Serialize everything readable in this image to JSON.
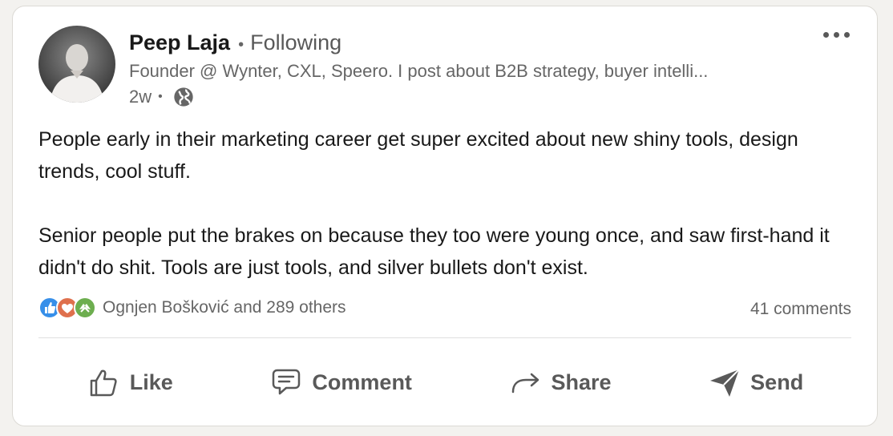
{
  "author": {
    "name": "Peep Laja",
    "follow_status": "Following",
    "headline": "Founder @ Wynter, CXL, Speero. I post about B2B strategy, buyer intelli...",
    "time_ago": "2w",
    "visibility_icon": "globe-icon"
  },
  "post": {
    "paragraphs": [
      "People early in their marketing career get super excited about new shiny tools, design trends, cool stuff.",
      "Senior people put the brakes on because they too were young once, and saw first-hand it didn't do shit. Tools are just tools, and silver bullets don't exist."
    ]
  },
  "social": {
    "reaction_icons": [
      "like-icon",
      "love-icon",
      "support-icon"
    ],
    "reactions_text": "Ognjen Bošković and 289 others",
    "comments_text": "41 comments"
  },
  "actions": {
    "like": "Like",
    "comment": "Comment",
    "share": "Share",
    "send": "Send"
  },
  "colors": {
    "like_blue": "#378fe9",
    "love_red": "#df704d",
    "support_green": "#6dae4f",
    "text_gray": "#666666"
  }
}
